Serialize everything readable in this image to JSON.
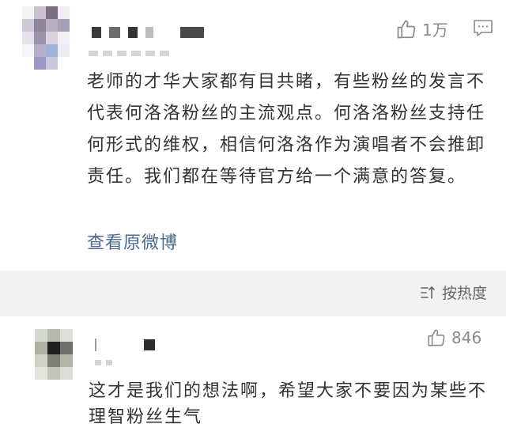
{
  "main_comment": {
    "like_count": "1万",
    "like_icon": "thumbs-up-icon",
    "comment_icon": "comment-icon",
    "text": "老师的才华大家都有目共睹，有些粉丝的发言不代表何洛洛粉丝的主流观点。何洛洛粉丝支持任何形式的维权，相信何洛洛作为演唱者不会推卸责任。我们都在等待官方给一个满意的答复。",
    "view_original_label": "查看原微博"
  },
  "sort": {
    "label": "按热度",
    "icon": "sort-icon"
  },
  "reply_comment": {
    "like_count": "846",
    "like_icon": "thumbs-up-icon",
    "text": "这才是我们的想法啊，希望大家不要因为某些不理智粉丝生气"
  },
  "colors": {
    "link": "#4b6a92",
    "secondary_text": "#8a8a8a",
    "sort_bar_bg": "#f2f2f2"
  }
}
